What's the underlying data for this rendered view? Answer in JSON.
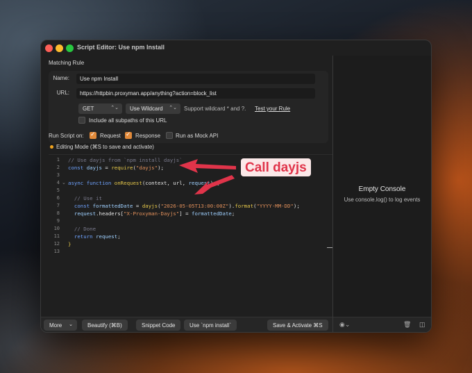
{
  "window": {
    "title": "Script Editor: Use npm Install"
  },
  "matching_rule": {
    "section_title": "Matching Rule",
    "name_label": "Name:",
    "name_value": "Use npm Install",
    "url_label": "URL:",
    "url_value": "https://httpbin.proxyman.app/anything?action=block_list",
    "method": "GET",
    "match_type": "Use Wildcard",
    "wildcard_hint": "Support wildcard * and ?.",
    "test_link": "Test your Rule",
    "include_subpaths": "Include all subpaths of this URL",
    "include_subpaths_checked": false
  },
  "run_script": {
    "label": "Run Script on:",
    "request": "Request",
    "request_checked": true,
    "response": "Response",
    "response_checked": true,
    "mock_api": "Run as Mock API",
    "mock_api_checked": false,
    "mode_text": "Editing Mode (⌘S to save and activate)",
    "mode_color": "#f0a31e"
  },
  "editor": {
    "line_numbers": [
      "1",
      "2",
      "3",
      "4",
      "5",
      "6",
      "7",
      "8",
      "9",
      "10",
      "11",
      "12",
      "13"
    ],
    "lines": [
      "// Use dayjs from `npm install dayjs`",
      "const dayjs = require(\"dayjs\");",
      "",
      "async function onRequest(context, url, request) {",
      "",
      "  // Use it",
      "  const formattedDate = dayjs(\"2026-05-05T13:00:00Z\").format(\"YYYY-MM-DD\");",
      "  request.headers[\"X-Proxyman-Dayjs\"] = formattedDate;",
      "",
      "  // Done",
      "  return request;",
      "}",
      ""
    ]
  },
  "bottom_bar": {
    "more": "More",
    "beautify": "Beautify (⌘B)",
    "snippet": "Snippet Code",
    "npm_install": "Use `npm install`",
    "save": "Save & Activate ⌘S"
  },
  "console": {
    "title": "Empty Console",
    "subtitle": "Use console.log() to log events"
  },
  "annotation": {
    "callout": "Call dayjs",
    "color": "#e0344a"
  },
  "icons": {
    "dropdown": "chevron-updown-icon",
    "fold": "chevron-down-icon",
    "eye": "eye-icon",
    "trash": "trash-icon",
    "sidebar": "sidebar-toggle-icon"
  }
}
